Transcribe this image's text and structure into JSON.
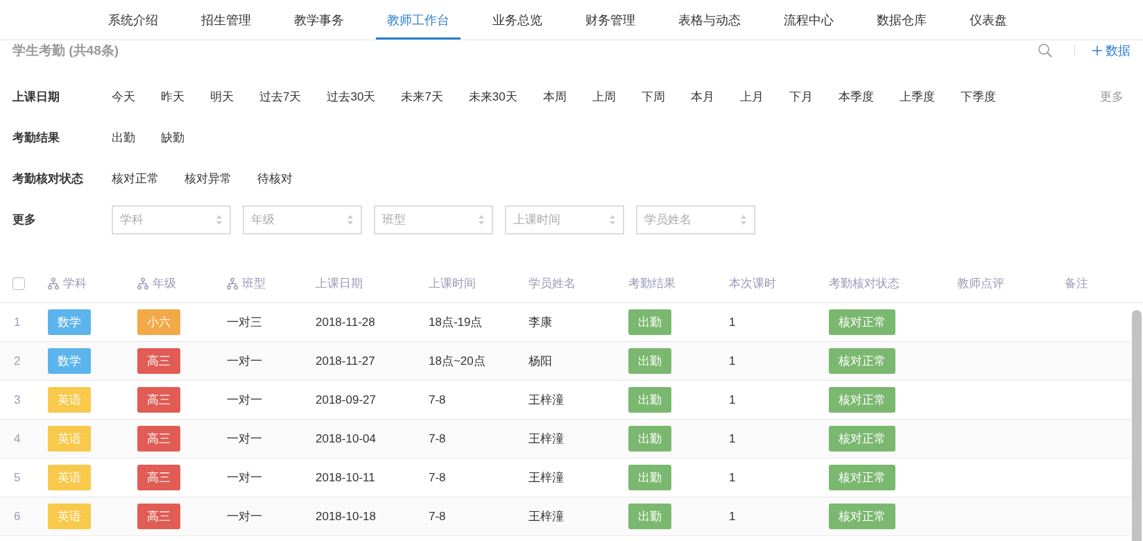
{
  "nav": {
    "items": [
      {
        "label": "系统介绍",
        "selected": false
      },
      {
        "label": "招生管理",
        "selected": false
      },
      {
        "label": "教学事务",
        "selected": false
      },
      {
        "label": "教师工作台",
        "selected": true
      },
      {
        "label": "业务总览",
        "selected": false
      },
      {
        "label": "财务管理",
        "selected": false
      },
      {
        "label": "表格与动态",
        "selected": false
      },
      {
        "label": "流程中心",
        "selected": false
      },
      {
        "label": "数据仓库",
        "selected": false
      },
      {
        "label": "仪表盘",
        "selected": false
      }
    ]
  },
  "header": {
    "title": "学生考勤 (共48条)",
    "add_label": "数据"
  },
  "filters": [
    {
      "kind": "options",
      "label": "上课日期",
      "options": [
        "今天",
        "昨天",
        "明天",
        "过去7天",
        "过去30天",
        "未来7天",
        "未来30天",
        "本周",
        "上周",
        "下周",
        "本月",
        "上月",
        "下月",
        "本季度",
        "上季度",
        "下季度"
      ],
      "more": "更多"
    },
    {
      "kind": "options",
      "label": "考勤结果",
      "options": [
        "出勤",
        "缺勤"
      ]
    },
    {
      "kind": "options",
      "label": "考勤核对状态",
      "options": [
        "核对正常",
        "核对异常",
        "待核对"
      ]
    },
    {
      "kind": "selects",
      "label": "更多",
      "selects": [
        {
          "placeholder": "学科"
        },
        {
          "placeholder": "年级"
        },
        {
          "placeholder": "班型"
        },
        {
          "placeholder": "上课时间"
        },
        {
          "placeholder": "学员姓名"
        }
      ]
    }
  ],
  "table": {
    "select_all": {
      "checked": false
    },
    "columns": [
      {
        "label": "学科",
        "kind": "grouped"
      },
      {
        "label": "年级",
        "kind": "grouped"
      },
      {
        "label": "班型",
        "kind": "grouped"
      },
      {
        "label": "上课日期",
        "kind": "plain"
      },
      {
        "label": "上课时间",
        "kind": "plain"
      },
      {
        "label": "学员姓名",
        "kind": "plain"
      },
      {
        "label": "考勤结果",
        "kind": "plain"
      },
      {
        "label": "本次课时",
        "kind": "plain"
      },
      {
        "label": "考勤核对状态",
        "kind": "plain"
      },
      {
        "label": "教师点评",
        "kind": "plain"
      },
      {
        "label": "备注",
        "kind": "plain"
      }
    ],
    "rows": [
      {
        "index": "1",
        "subject": {
          "text": "数学",
          "color": "#5bb4ec"
        },
        "grade": {
          "text": "小六",
          "color": "#f2a947"
        },
        "class_type": "一对三",
        "date": "2018-11-28",
        "time": "18点-19点",
        "student": "李康",
        "result": {
          "text": "出勤",
          "color": "#7bb86f"
        },
        "hours": "1",
        "check_status": {
          "text": "核对正常",
          "color": "#7bb86f"
        }
      },
      {
        "index": "2",
        "subject": {
          "text": "数学",
          "color": "#5bb4ec"
        },
        "grade": {
          "text": "高三",
          "color": "#e05c54"
        },
        "class_type": "一对一",
        "date": "2018-11-27",
        "time": "18点~20点",
        "student": "杨阳",
        "result": {
          "text": "出勤",
          "color": "#7bb86f"
        },
        "hours": "1",
        "check_status": {
          "text": "核对正常",
          "color": "#7bb86f"
        }
      },
      {
        "index": "3",
        "subject": {
          "text": "英语",
          "color": "#f8c94b"
        },
        "grade": {
          "text": "高三",
          "color": "#e05c54"
        },
        "class_type": "一对一",
        "date": "2018-09-27",
        "time": "7-8",
        "student": "王梓潼",
        "result": {
          "text": "出勤",
          "color": "#7bb86f"
        },
        "hours": "1",
        "check_status": {
          "text": "核对正常",
          "color": "#7bb86f"
        }
      },
      {
        "index": "4",
        "subject": {
          "text": "英语",
          "color": "#f8c94b"
        },
        "grade": {
          "text": "高三",
          "color": "#e05c54"
        },
        "class_type": "一对一",
        "date": "2018-10-04",
        "time": "7-8",
        "student": "王梓潼",
        "result": {
          "text": "出勤",
          "color": "#7bb86f"
        },
        "hours": "1",
        "check_status": {
          "text": "核对正常",
          "color": "#7bb86f"
        }
      },
      {
        "index": "5",
        "subject": {
          "text": "英语",
          "color": "#f8c94b"
        },
        "grade": {
          "text": "高三",
          "color": "#e05c54"
        },
        "class_type": "一对一",
        "date": "2018-10-11",
        "time": "7-8",
        "student": "王梓潼",
        "result": {
          "text": "出勤",
          "color": "#7bb86f"
        },
        "hours": "1",
        "check_status": {
          "text": "核对正常",
          "color": "#7bb86f"
        }
      },
      {
        "index": "6",
        "subject": {
          "text": "英语",
          "color": "#f8c94b"
        },
        "grade": {
          "text": "高三",
          "color": "#e05c54"
        },
        "class_type": "一对一",
        "date": "2018-10-18",
        "time": "7-8",
        "student": "王梓潼",
        "result": {
          "text": "出勤",
          "color": "#7bb86f"
        },
        "hours": "1",
        "check_status": {
          "text": "核对正常",
          "color": "#7bb86f"
        }
      }
    ]
  }
}
